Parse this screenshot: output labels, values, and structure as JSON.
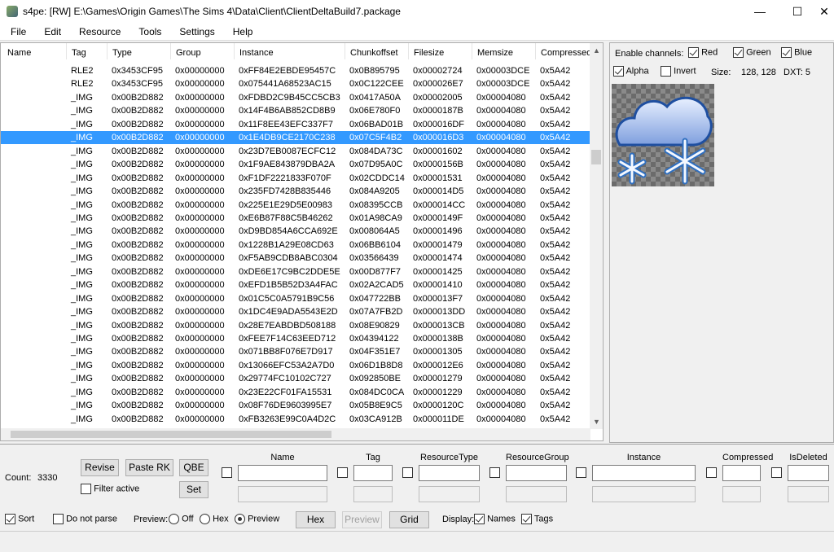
{
  "window": {
    "title": "s4pe: [RW] E:\\Games\\Origin Games\\The Sims 4\\Data\\Client\\ClientDeltaBuild7.package",
    "minimize": "—",
    "maximize": "☐",
    "close": "✕"
  },
  "menu": [
    "File",
    "Edit",
    "Resource",
    "Tools",
    "Settings",
    "Help"
  ],
  "columns": [
    "Name",
    "Tag",
    "Type",
    "Group",
    "Instance",
    "Chunkoffset",
    "Filesize",
    "Memsize",
    "Compressed"
  ],
  "rows": [
    [
      "",
      "RLE2",
      "0x3453CF95",
      "0x00000000",
      "0xFF84E2EBDE95457C",
      "0x0B895795",
      "0x00002724",
      "0x00003DCE",
      "0x5A42"
    ],
    [
      "",
      "RLE2",
      "0x3453CF95",
      "0x00000000",
      "0x075441A68523AC15",
      "0x0C122CEE",
      "0x000026E7",
      "0x00003DCE",
      "0x5A42"
    ],
    [
      "",
      "_IMG",
      "0x00B2D882",
      "0x00000000",
      "0xFDBD2C9B45CC5CB3",
      "0x0417A50A",
      "0x00002005",
      "0x00004080",
      "0x5A42"
    ],
    [
      "",
      "_IMG",
      "0x00B2D882",
      "0x00000000",
      "0x14F4B6AB852CD8B9",
      "0x06E780F0",
      "0x0000187B",
      "0x00004080",
      "0x5A42"
    ],
    [
      "",
      "_IMG",
      "0x00B2D882",
      "0x00000000",
      "0x11F8EE43EFC337F7",
      "0x06BAD01B",
      "0x000016DF",
      "0x00004080",
      "0x5A42"
    ],
    [
      "",
      "_IMG",
      "0x00B2D882",
      "0x00000000",
      "0x1E4DB9CE2170C238",
      "0x07C5F4B2",
      "0x000016D3",
      "0x00004080",
      "0x5A42"
    ],
    [
      "",
      "_IMG",
      "0x00B2D882",
      "0x00000000",
      "0x23D7EB0087ECFC12",
      "0x084DA73C",
      "0x00001602",
      "0x00004080",
      "0x5A42"
    ],
    [
      "",
      "_IMG",
      "0x00B2D882",
      "0x00000000",
      "0x1F9AE843879DBA2A",
      "0x07D95A0C",
      "0x0000156B",
      "0x00004080",
      "0x5A42"
    ],
    [
      "",
      "_IMG",
      "0x00B2D882",
      "0x00000000",
      "0xF1DF2221833F070F",
      "0x02CDDC14",
      "0x00001531",
      "0x00004080",
      "0x5A42"
    ],
    [
      "",
      "_IMG",
      "0x00B2D882",
      "0x00000000",
      "0x235FD7428B835446",
      "0x084A9205",
      "0x000014D5",
      "0x00004080",
      "0x5A42"
    ],
    [
      "",
      "_IMG",
      "0x00B2D882",
      "0x00000000",
      "0x225E1E29D5E00983",
      "0x08395CCB",
      "0x000014CC",
      "0x00004080",
      "0x5A42"
    ],
    [
      "",
      "_IMG",
      "0x00B2D882",
      "0x00000000",
      "0xE6B87F88C5B46262",
      "0x01A98CA9",
      "0x0000149F",
      "0x00004080",
      "0x5A42"
    ],
    [
      "",
      "_IMG",
      "0x00B2D882",
      "0x00000000",
      "0xD9BD854A6CCA692E",
      "0x008064A5",
      "0x00001496",
      "0x00004080",
      "0x5A42"
    ],
    [
      "",
      "_IMG",
      "0x00B2D882",
      "0x00000000",
      "0x1228B1A29E08CD63",
      "0x06BB6104",
      "0x00001479",
      "0x00004080",
      "0x5A42"
    ],
    [
      "",
      "_IMG",
      "0x00B2D882",
      "0x00000000",
      "0xF5AB9CDB8ABC0304",
      "0x03566439",
      "0x00001474",
      "0x00004080",
      "0x5A42"
    ],
    [
      "",
      "_IMG",
      "0x00B2D882",
      "0x00000000",
      "0xDE6E17C9BC2DDE5E",
      "0x00D877F7",
      "0x00001425",
      "0x00004080",
      "0x5A42"
    ],
    [
      "",
      "_IMG",
      "0x00B2D882",
      "0x00000000",
      "0xEFD1B5B52D3A4FAC",
      "0x02A2CAD5",
      "0x00001410",
      "0x00004080",
      "0x5A42"
    ],
    [
      "",
      "_IMG",
      "0x00B2D882",
      "0x00000000",
      "0x01C5C0A5791B9C56",
      "0x047722BB",
      "0x000013F7",
      "0x00004080",
      "0x5A42"
    ],
    [
      "",
      "_IMG",
      "0x00B2D882",
      "0x00000000",
      "0x1DC4E9ADA5543E2D",
      "0x07A7FB2D",
      "0x000013DD",
      "0x00004080",
      "0x5A42"
    ],
    [
      "",
      "_IMG",
      "0x00B2D882",
      "0x00000000",
      "0x28E7EABDBD508188",
      "0x08E90829",
      "0x000013CB",
      "0x00004080",
      "0x5A42"
    ],
    [
      "",
      "_IMG",
      "0x00B2D882",
      "0x00000000",
      "0xFEE7F14C63EED712",
      "0x04394122",
      "0x0000138B",
      "0x00004080",
      "0x5A42"
    ],
    [
      "",
      "_IMG",
      "0x00B2D882",
      "0x00000000",
      "0x071BB8F076E7D917",
      "0x04F351E7",
      "0x00001305",
      "0x00004080",
      "0x5A42"
    ],
    [
      "",
      "_IMG",
      "0x00B2D882",
      "0x00000000",
      "0x13066EFC53A2A7D0",
      "0x06D1B8D8",
      "0x000012E6",
      "0x00004080",
      "0x5A42"
    ],
    [
      "",
      "_IMG",
      "0x00B2D882",
      "0x00000000",
      "0x29774FC10102C727",
      "0x092850BE",
      "0x00001279",
      "0x00004080",
      "0x5A42"
    ],
    [
      "",
      "_IMG",
      "0x00B2D882",
      "0x00000000",
      "0x23E22CF01FA15531",
      "0x084DC0CA",
      "0x00001229",
      "0x00004080",
      "0x5A42"
    ],
    [
      "",
      "_IMG",
      "0x00B2D882",
      "0x00000000",
      "0x08F76DE9603995E7",
      "0x05B8E9C5",
      "0x0000120C",
      "0x00004080",
      "0x5A42"
    ],
    [
      "",
      "_IMG",
      "0x00B2D882",
      "0x00000000",
      "0xFB3263E99C0A4D2C",
      "0x03CA912B",
      "0x000011DE",
      "0x00004080",
      "0x5A42"
    ]
  ],
  "selected_row": 5,
  "preview": {
    "enable_channels": "Enable channels:",
    "red": "Red",
    "green": "Green",
    "blue": "Blue",
    "alpha": "Alpha",
    "invert": "Invert",
    "size_label": "Size:",
    "size": "128, 128",
    "dxt": "DXT: 5",
    "image_icon": "snow-cloud-icon"
  },
  "bottom": {
    "count_label": "Count:",
    "count": "3330",
    "revise": "Revise",
    "paste_rk": "Paste RK",
    "qbe": "QBE",
    "set": "Set",
    "filter_active": "Filter active",
    "filters": [
      "Name",
      "Tag",
      "ResourceType",
      "ResourceGroup",
      "Instance",
      "Compressed",
      "IsDeleted"
    ],
    "sort": "Sort",
    "do_not_parse": "Do not parse",
    "preview_label": "Preview:",
    "off": "Off",
    "hex": "Hex",
    "preview": "Preview",
    "hex_btn": "Hex",
    "preview_btn": "Preview",
    "grid_btn": "Grid",
    "display_label": "Display:",
    "names": "Names",
    "tags": "Tags"
  },
  "colors": {
    "selection": "#3399ff"
  }
}
